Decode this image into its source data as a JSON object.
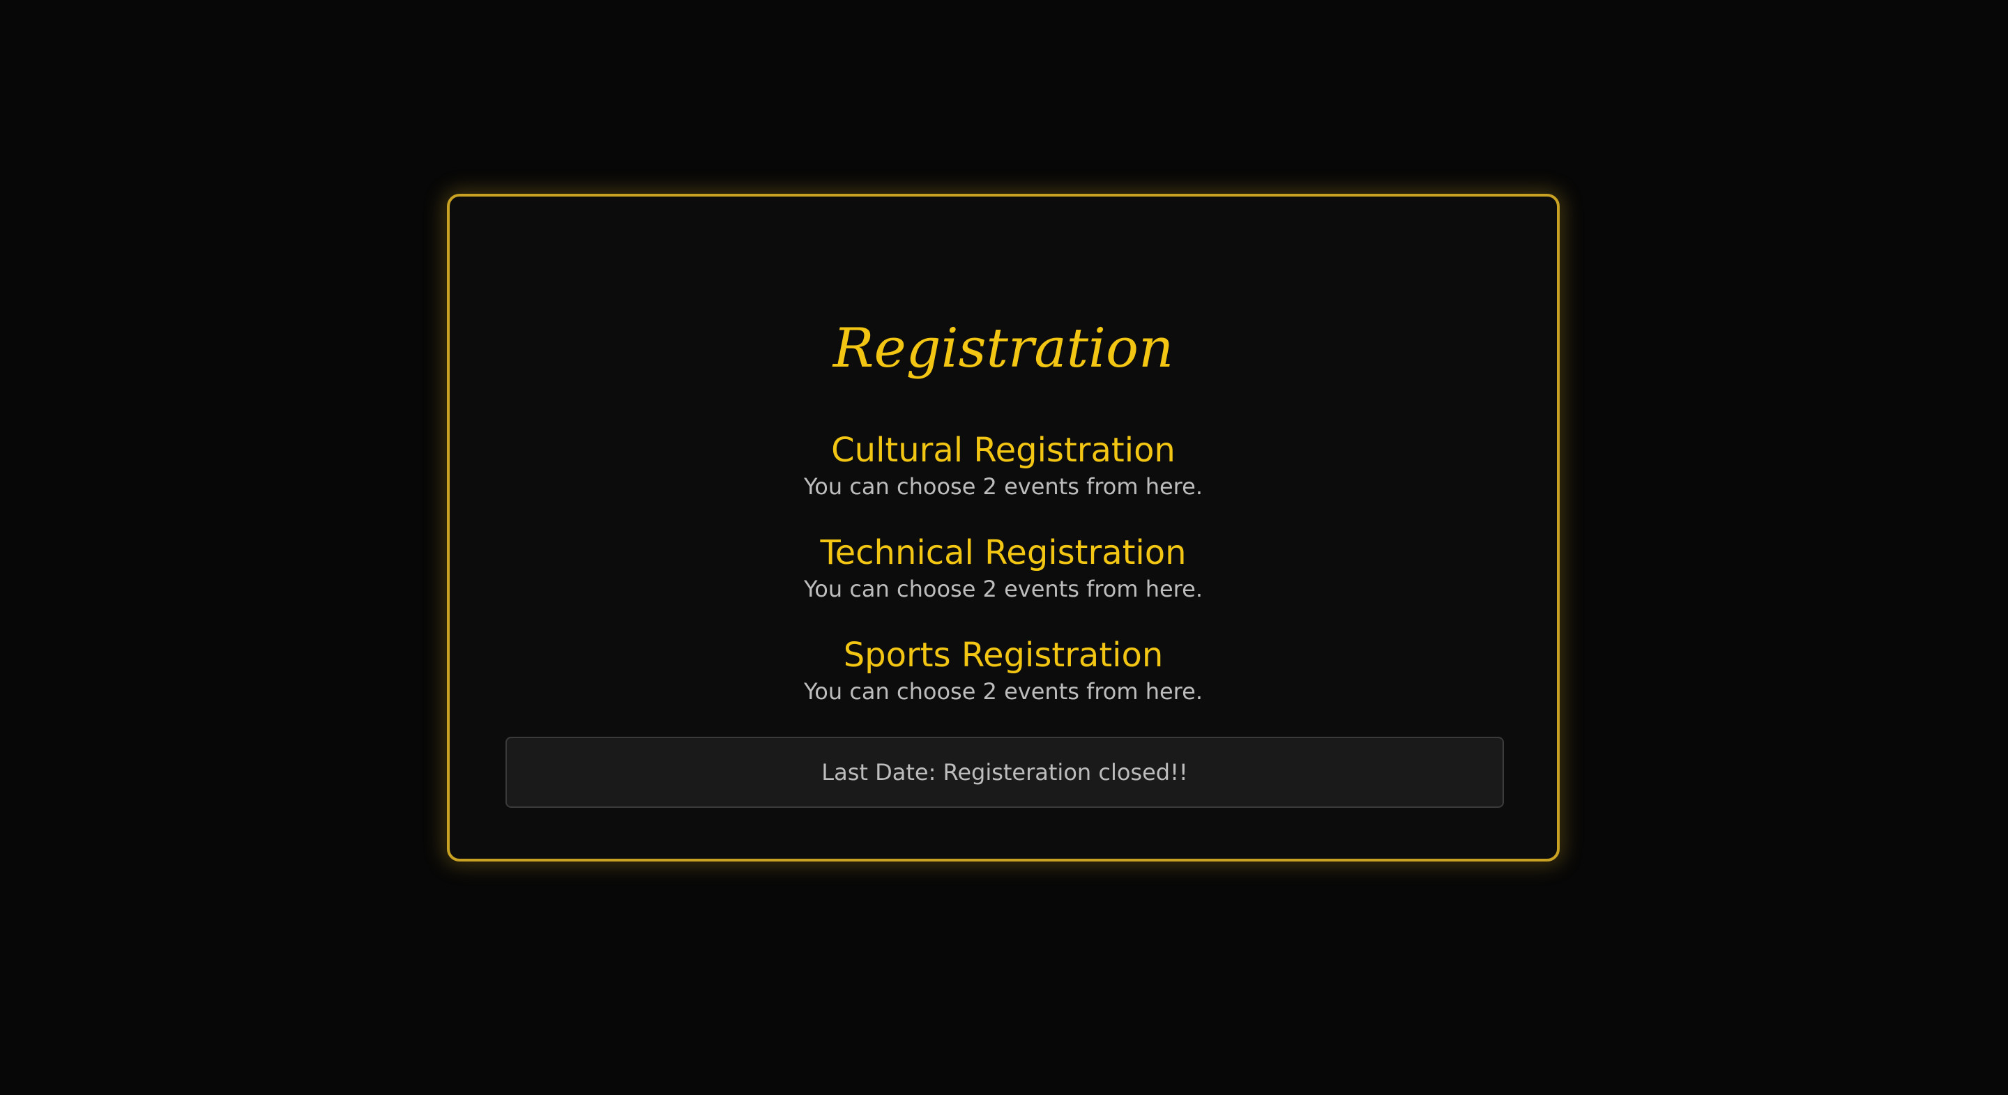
{
  "page": {
    "title": "Registration"
  },
  "sections": [
    {
      "title": "Cultural Registration",
      "description": "You can choose 2 events from here."
    },
    {
      "title": "Technical Registration",
      "description": "You can choose 2 events from here."
    },
    {
      "title": "Sports Registration",
      "description": "You can choose 2 events from here."
    }
  ],
  "notice": {
    "text": "Last Date: Registeration closed!!"
  },
  "colors": {
    "background": "#070707",
    "card_background": "#0c0c0c",
    "accent": "#f3c614",
    "border": "#c9a224",
    "muted_text": "#bdbdbd",
    "notice_background": "#1a1a1a"
  }
}
